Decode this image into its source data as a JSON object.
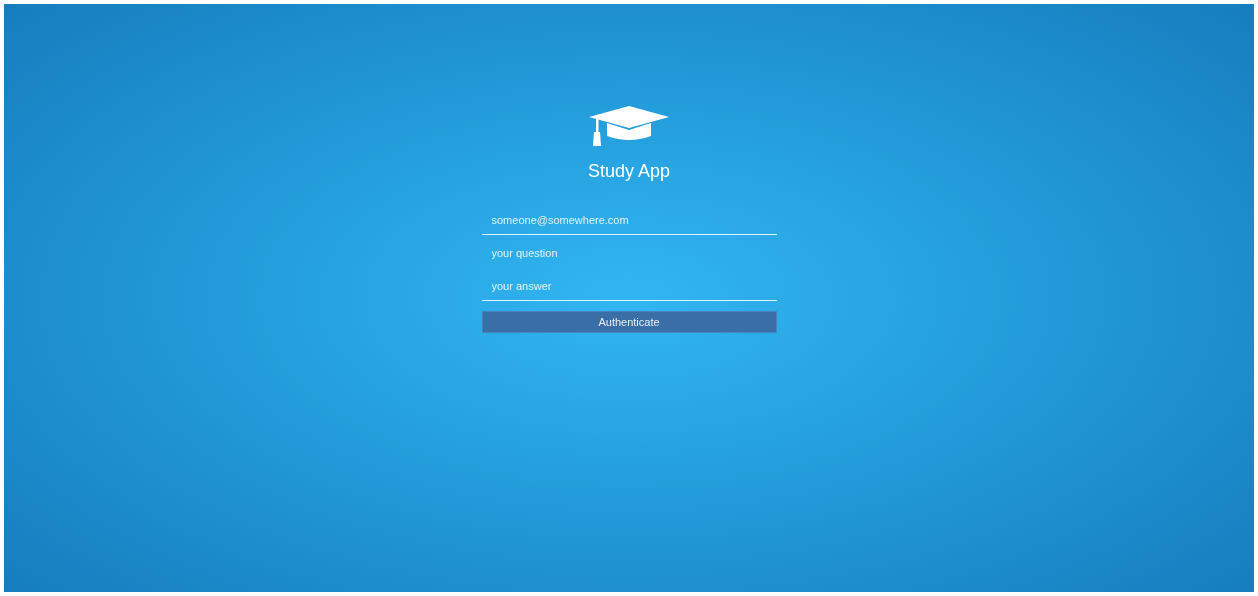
{
  "app": {
    "title": "Study App"
  },
  "fields": [
    {
      "placeholder": "someone@somewhere.com",
      "underlined": true
    },
    {
      "placeholder": "your question",
      "underlined": false
    },
    {
      "placeholder": "your answer",
      "underlined": true
    }
  ],
  "button": {
    "label": "Authenticate"
  }
}
